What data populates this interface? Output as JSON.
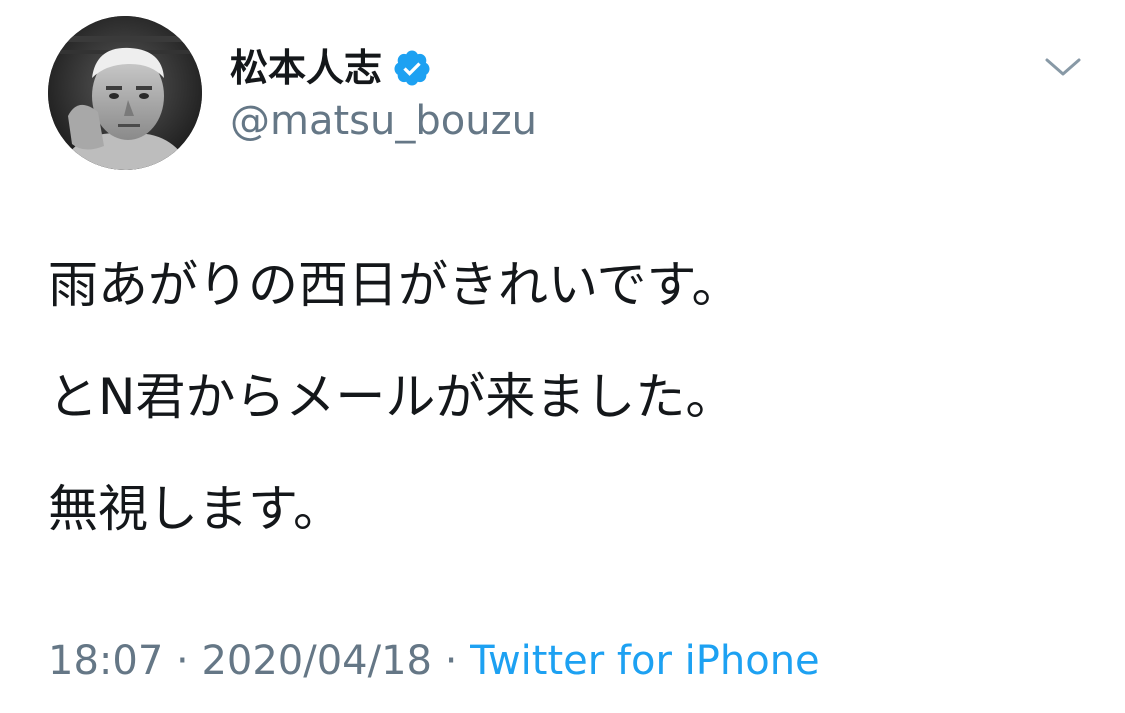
{
  "user": {
    "display_name": "松本人志",
    "handle": "@matsu_bouzu",
    "verified": true,
    "avatar_icon": "profile-photo"
  },
  "tweet": {
    "lines": [
      "雨あがりの西日がきれいです。",
      "とN君からメールが来ました。",
      "無視します。"
    ],
    "time": "18:07",
    "separator1": " · ",
    "date": "2020/04/18",
    "separator2": " · ",
    "source": "Twitter for iPhone"
  },
  "icons": {
    "verified": "verified-badge-icon",
    "menu": "chevron-down-icon"
  },
  "colors": {
    "text": "#14171a",
    "secondary": "#657786",
    "link": "#1da1f2",
    "verified": "#1da1f2"
  }
}
